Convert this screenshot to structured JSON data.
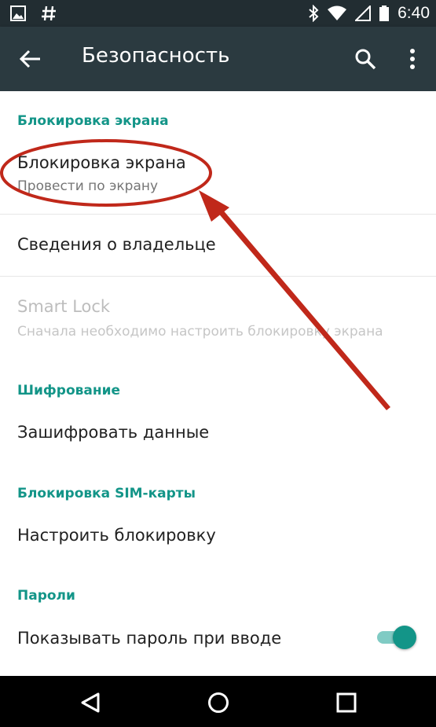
{
  "status_bar": {
    "time": "6:40",
    "icons_left": [
      "image-icon",
      "hash-icon"
    ],
    "icons_right": [
      "bluetooth-icon",
      "wifi-icon",
      "signal-icon",
      "battery-icon"
    ]
  },
  "toolbar": {
    "title": "Безопасность",
    "back_icon": "arrow-back-icon",
    "search_icon": "search-icon",
    "more_icon": "more-vert-icon"
  },
  "sections": {
    "screen_lock": {
      "header": "Блокировка экрана",
      "item_title": "Блокировка экрана",
      "item_sub": "Провести по экрану"
    },
    "owner_info": {
      "title": "Сведения о владельце"
    },
    "smart_lock": {
      "title": "Smart Lock",
      "sub": "Сначала необходимо настроить блокировку экрана"
    },
    "encryption": {
      "header": "Шифрование",
      "item_title": "Зашифровать данные"
    },
    "sim_lock": {
      "header": "Блокировка SIM-карты",
      "item_title": "Настроить блокировку"
    },
    "passwords": {
      "header": "Пароли",
      "item_title": "Показывать пароль при вводе",
      "switch_on": true
    }
  },
  "colors": {
    "accent": "#139588",
    "toolbar": "#2b3a40",
    "status_bar": "#222d32",
    "annotation": "#c0281a"
  },
  "nav_bar": {
    "icons": [
      "nav-back-icon",
      "nav-home-icon",
      "nav-recents-icon"
    ]
  }
}
